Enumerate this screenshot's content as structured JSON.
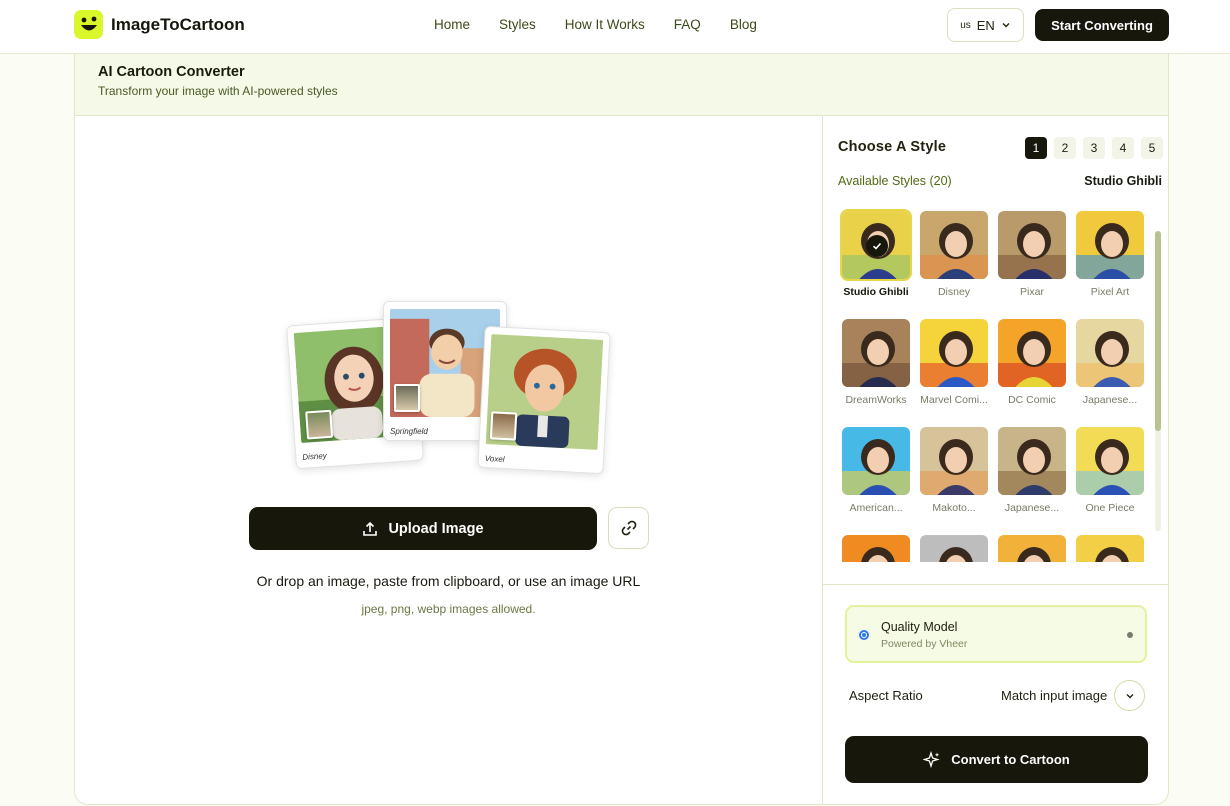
{
  "header": {
    "brand": "ImageToCartoon",
    "nav": [
      "Home",
      "Styles",
      "How It Works",
      "FAQ",
      "Blog"
    ],
    "lang_flag": "us",
    "lang_code": "EN",
    "start_label": "Start Converting"
  },
  "converter": {
    "title": "AI Cartoon Converter",
    "subtitle": "Transform your image with AI-powered styles"
  },
  "upload": {
    "samples": [
      "Disney",
      "Springfield",
      "Voxel"
    ],
    "button_label": "Upload Image",
    "drop_text": "Or drop an image, paste from clipboard, or use an image URL",
    "allowed_text": "jpeg, png, webp images allowed."
  },
  "styles": {
    "title": "Choose A Style",
    "pages": [
      "1",
      "2",
      "3",
      "4",
      "5"
    ],
    "active_page": "1",
    "available": "Available Styles (20)",
    "selected": "Studio Ghibli",
    "items": [
      {
        "label": "Studio Ghibli",
        "selected": true,
        "palette": [
          "#e9d24a",
          "#8fc16a",
          "#2c3d8e"
        ]
      },
      {
        "label": "Disney",
        "selected": false,
        "palette": [
          "#c9a66b",
          "#e58b3f",
          "#2b3f7a"
        ]
      },
      {
        "label": "Pixar",
        "selected": false,
        "palette": [
          "#b99a6a",
          "#7f5a3b",
          "#27306a"
        ]
      },
      {
        "label": "Pixel Art",
        "selected": false,
        "palette": [
          "#f0c93d",
          "#3b8fd8",
          "#2b4fa6"
        ]
      },
      {
        "label": "DreamWorks",
        "selected": false,
        "palette": [
          "#a7825a",
          "#6e4d33",
          "#262c4d"
        ]
      },
      {
        "label": "Marvel Comi...",
        "selected": false,
        "palette": [
          "#f4d43a",
          "#e2452c",
          "#2b58c6"
        ]
      },
      {
        "label": "DC Comic",
        "selected": false,
        "palette": [
          "#f5a42a",
          "#d63b22",
          "#e7d535"
        ]
      },
      {
        "label": "Japanese...",
        "selected": false,
        "palette": [
          "#e6d6a0",
          "#f1b95b",
          "#3b5bb0"
        ]
      },
      {
        "label": "American...",
        "selected": false,
        "palette": [
          "#47b9e6",
          "#f1d13b",
          "#2a4fb2"
        ]
      },
      {
        "label": "Makoto...",
        "selected": false,
        "palette": [
          "#d6c39a",
          "#e59a55",
          "#3a3a6a"
        ]
      },
      {
        "label": "Japanese...",
        "selected": false,
        "palette": [
          "#c7b488",
          "#8a6a43",
          "#2f3b6a"
        ]
      },
      {
        "label": "One Piece",
        "selected": false,
        "palette": [
          "#f3dc55",
          "#7cc3e2",
          "#2a52b4"
        ]
      },
      {
        "label": "",
        "selected": false,
        "palette": [
          "#f08b22",
          "#f1d13b",
          "#3a7ac8"
        ]
      },
      {
        "label": "",
        "selected": false,
        "palette": [
          "#bdbdbd",
          "#5a5a5a",
          "#e8e8e8"
        ]
      },
      {
        "label": "",
        "selected": false,
        "palette": [
          "#f2b23a",
          "#f27a2a",
          "#3f8ad6"
        ]
      },
      {
        "label": "",
        "selected": false,
        "palette": [
          "#f2cf45",
          "#e6572d",
          "#4a9adf"
        ]
      }
    ]
  },
  "model": {
    "name": "Quality Model",
    "sub": "Powered by Vheer"
  },
  "aspect": {
    "label": "Aspect Ratio",
    "value": "Match input image"
  },
  "convert_label": "Convert to Cartoon",
  "colors": {
    "accent": "#d9f72b",
    "dark": "#17170b",
    "radio": "#2f7bea"
  }
}
